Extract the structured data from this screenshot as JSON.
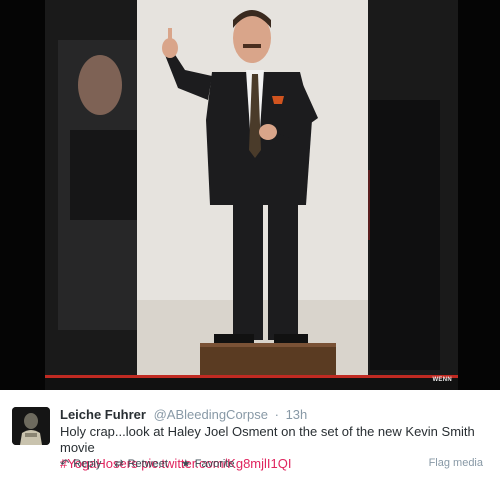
{
  "media": {
    "watermark": "WENN",
    "colors": {
      "background": "#050505",
      "wall": "#e6e3de",
      "suit": "#1c1c1e",
      "podium": "#5a3b22",
      "red_strip": "#c02a22"
    }
  },
  "tweet": {
    "display_name": "Leiche Fuhrer",
    "username": "@ABleedingCorpse",
    "separator": "·",
    "timestamp": "13h",
    "text_plain": "Holy crap...look at Haley Joel Osment on the set of the new Kevin Smith movie",
    "hashtag": "#YogaHosers",
    "link": "pic.twitter.com/Kg8mjlI1QI",
    "actions": {
      "reply": {
        "label": "Reply",
        "icon": "reply-icon"
      },
      "retweet": {
        "label": "Retweet",
        "icon": "retweet-icon"
      },
      "favorite": {
        "label": "Favorite",
        "icon": "star-icon"
      }
    },
    "flag_label": "Flag media",
    "accent_color": "#e0245e"
  }
}
